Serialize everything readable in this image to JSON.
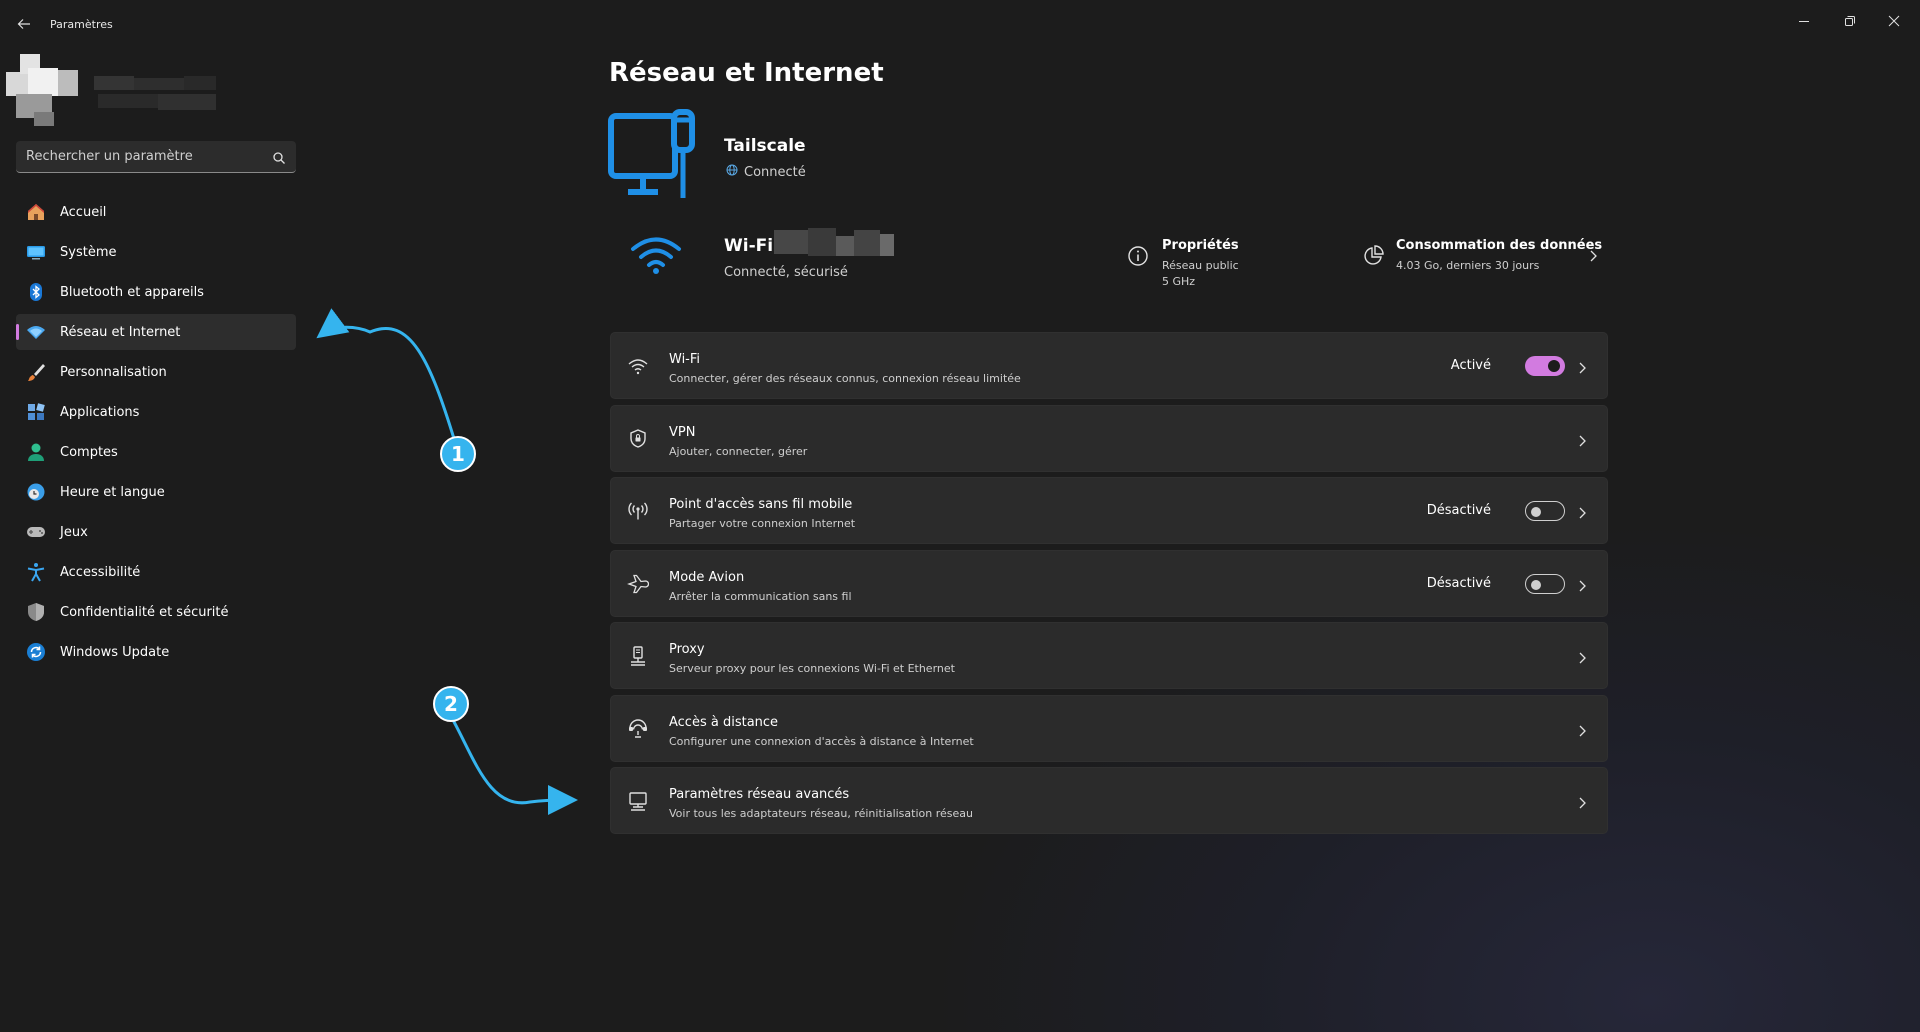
{
  "window": {
    "title": "Paramètres",
    "back_icon": "back-arrow-icon",
    "controls": [
      "minimize-icon",
      "restore-icon",
      "close-icon"
    ]
  },
  "search": {
    "placeholder": "Rechercher un paramètre"
  },
  "sidebar": {
    "items": [
      {
        "label": "Accueil",
        "icon": "home-icon"
      },
      {
        "label": "Système",
        "icon": "system-icon"
      },
      {
        "label": "Bluetooth et appareils",
        "icon": "bluetooth-icon"
      },
      {
        "label": "Réseau et Internet",
        "icon": "network-icon",
        "active": true
      },
      {
        "label": "Personnalisation",
        "icon": "brush-icon"
      },
      {
        "label": "Applications",
        "icon": "apps-icon"
      },
      {
        "label": "Comptes",
        "icon": "account-icon"
      },
      {
        "label": "Heure et langue",
        "icon": "clock-globe-icon"
      },
      {
        "label": "Jeux",
        "icon": "gamepad-icon"
      },
      {
        "label": "Accessibilité",
        "icon": "accessibility-icon"
      },
      {
        "label": "Confidentialité et sécurité",
        "icon": "shield-icon"
      },
      {
        "label": "Windows Update",
        "icon": "update-icon"
      }
    ]
  },
  "main": {
    "title": "Réseau et Internet",
    "vpn_connection": {
      "name": "Tailscale",
      "status": "Connecté"
    },
    "wifi": {
      "name": "Wi-Fi",
      "status": "Connecté, sécurisé"
    },
    "properties": {
      "title": "Propriétés",
      "line1": "Réseau public",
      "line2": "5 GHz"
    },
    "data_usage": {
      "title": "Consommation des données",
      "subtitle": "4.03 Go, derniers 30 jours"
    },
    "cards": [
      {
        "title": "Wi-Fi",
        "subtitle": "Connecter, gérer des réseaux connus, connexion réseau limitée",
        "state": "Activé",
        "toggle": "on",
        "icon": "wifi-icon"
      },
      {
        "title": "VPN",
        "subtitle": "Ajouter, connecter, gérer",
        "state": "",
        "icon": "vpn-shield-icon"
      },
      {
        "title": "Point d'accès sans fil mobile",
        "subtitle": "Partager votre connexion Internet",
        "state": "Désactivé",
        "toggle": "off",
        "icon": "hotspot-icon"
      },
      {
        "title": "Mode Avion",
        "subtitle": "Arrêter la communication sans fil",
        "state": "Désactivé",
        "toggle": "off",
        "icon": "airplane-icon"
      },
      {
        "title": "Proxy",
        "subtitle": "Serveur proxy pour les connexions Wi-Fi et Ethernet",
        "state": "",
        "icon": "proxy-icon"
      },
      {
        "title": "Accès à distance",
        "subtitle": "Configurer une connexion d'accès à distance à Internet",
        "state": "",
        "icon": "dialup-icon"
      },
      {
        "title": "Paramètres réseau avancés",
        "subtitle": "Voir tous les adaptateurs réseau, réinitialisation réseau",
        "state": "",
        "icon": "advanced-network-icon"
      }
    ]
  },
  "annotations": {
    "badge1": "1",
    "badge2": "2"
  },
  "colors": {
    "accent": "#d27be0",
    "annotation": "#35b4ee",
    "network_blue": "#1f8fe6"
  }
}
